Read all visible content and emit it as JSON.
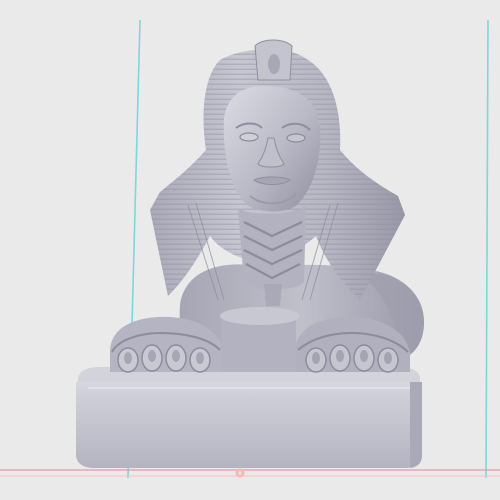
{
  "viewport": {
    "background": "#eaeaea",
    "model_color": "#b8b8c4",
    "model_shadow": "#8d8d9c",
    "model_highlight": "#dcdce4",
    "build_volume_color": "#7fd6da",
    "bed_edge_color": "#e99aa0",
    "origin_marker_color": "#f2b7b7"
  },
  "scene": {
    "object_name": "sphinx-model",
    "object_icon": "sphinx-model-icon",
    "origin_icon": "origin-marker-icon"
  }
}
